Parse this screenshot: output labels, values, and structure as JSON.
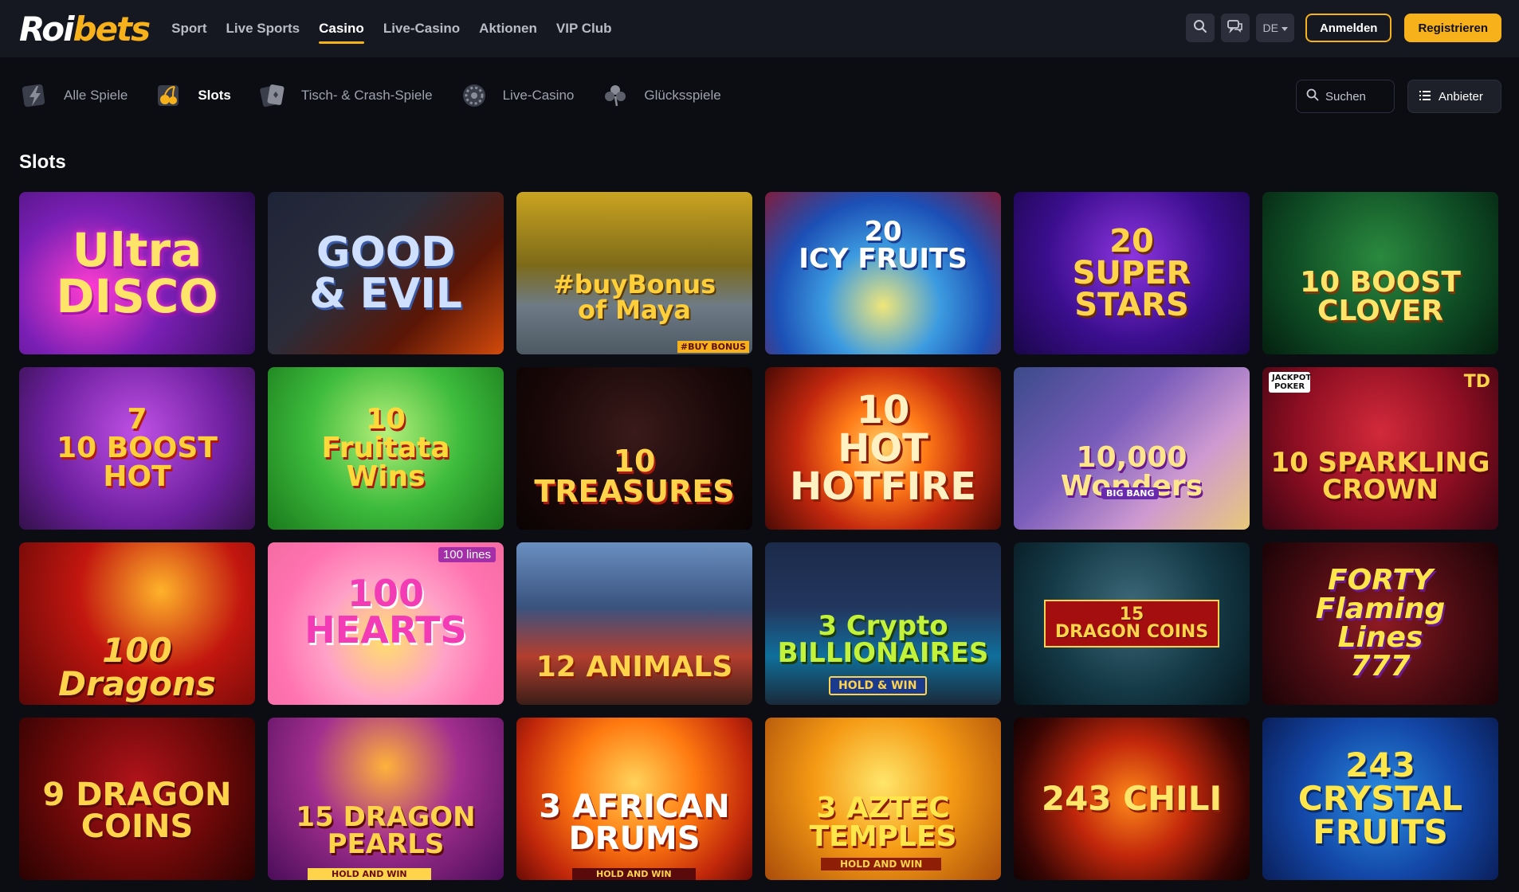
{
  "brand": {
    "part1": "Roi",
    "part2": "bets"
  },
  "nav": [
    {
      "label": "Sport"
    },
    {
      "label": "Live Sports"
    },
    {
      "label": "Casino",
      "active": true
    },
    {
      "label": "Live-Casino"
    },
    {
      "label": "Aktionen"
    },
    {
      "label": "VIP Club"
    }
  ],
  "header_actions": {
    "search_icon": "search-icon",
    "chat_icon": "chat-icon",
    "language": "DE",
    "login": "Anmelden",
    "register": "Registrieren"
  },
  "categories": [
    {
      "label": "Alle Spiele",
      "icon": "lightning-icon"
    },
    {
      "label": "Slots",
      "icon": "cherries-icon",
      "active": true
    },
    {
      "label": "Tisch- & Crash-Spiele",
      "icon": "cards-icon"
    },
    {
      "label": "Live-Casino",
      "icon": "roulette-icon"
    },
    {
      "label": "Glücksspiele",
      "icon": "clover-icon"
    }
  ],
  "search": {
    "placeholder": "Suchen"
  },
  "provider_button": "Anbieter",
  "section_title": "Slots",
  "games": [
    {
      "title": "Ultra\nDISCO"
    },
    {
      "title": "GOOD\n& EVIL"
    },
    {
      "title": "#buyBonus\nof Maya",
      "badge": "#BUY BONUS"
    },
    {
      "title": "20\nICY FRUITS"
    },
    {
      "title": "20\nSUPER STARS"
    },
    {
      "title": "10 BOOST\nCLOVER"
    },
    {
      "title": "7\n10 BOOST HOT"
    },
    {
      "title": "10\nFruitata\nWins"
    },
    {
      "title": "10\nTREASURES"
    },
    {
      "title": "10\nHOT\nHOTFIRE"
    },
    {
      "title": "10,000\nWonders",
      "badge": "BIG BANG"
    },
    {
      "title": "10 SPARKLING\nCROWN",
      "badge": "JACKPOT POKER",
      "badge2": "TD"
    },
    {
      "title": "100 Dragons"
    },
    {
      "title": "100\nHEARTS",
      "badge": "100 lines"
    },
    {
      "title": "12 ANIMALS"
    },
    {
      "title": "3 Crypto\nBILLIONAIRES",
      "badge": "HOLD & WIN"
    },
    {
      "title": "15\nDRAGON COINS"
    },
    {
      "title": "FORTY\nFlaming\nLines\n777"
    },
    {
      "title": "9 DRAGON\nCOINS"
    },
    {
      "title": "15 DRAGON\nPEARLS",
      "badge": "HOLD AND WIN"
    },
    {
      "title": "3 AFRICAN\nDRUMS",
      "badge": "HOLD AND WIN"
    },
    {
      "title": "3 AZTEC\nTEMPLES",
      "badge": "HOLD AND WIN"
    },
    {
      "title": "243 CHILI"
    },
    {
      "title": "243\nCRYSTAL\nFRUITS"
    }
  ]
}
